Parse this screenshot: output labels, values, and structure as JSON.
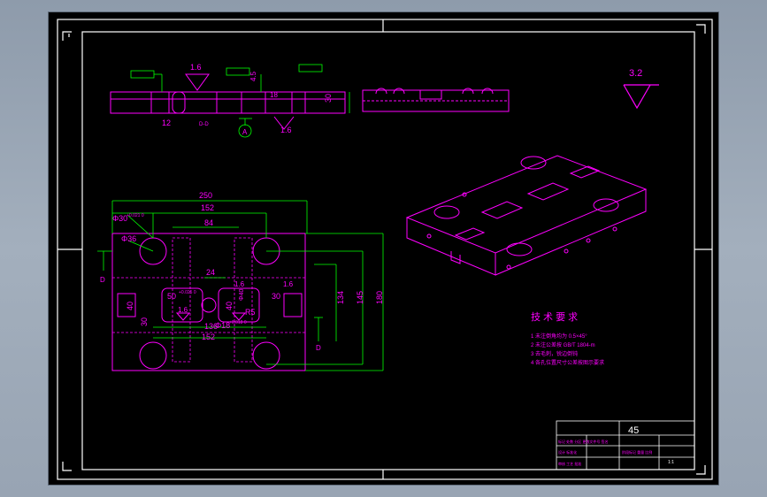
{
  "window": {
    "title": ""
  },
  "colors": {
    "background": "#000000",
    "frame": "#ffffff",
    "part": "#ff00ff",
    "dimension": "#00ff00",
    "text": "#ff00ff"
  },
  "top_view": {
    "dim_width": "250",
    "dim_152_top": "152",
    "dim_84": "84",
    "dim_24": "24",
    "dim_136": "136",
    "dim_152_bottom": "152",
    "dim_134": "134",
    "dim_145": "145",
    "dim_180": "180",
    "phi30": "Φ30",
    "phi30_tol": "+0.021 0",
    "phi36": "Φ36",
    "dim_50": "50",
    "dim_50_tol": "+0.025 0",
    "dim_40_left": "40",
    "dim_40_right": "40",
    "dim_30_left": "30",
    "dim_30_right": "30",
    "phi40": "Φ40",
    "phi18": "Φ18",
    "phi18_tol": "+0.018 0",
    "r5": "R5",
    "rough_16_a": "1.6",
    "rough_16_b": "1.6",
    "rough_16_c": "1.6",
    "label_d_left": "D",
    "label_d_right": "D"
  },
  "section_view": {
    "rough_top": "1.6",
    "rough_bottom": "1.6",
    "dim_12": "12",
    "dim_30": "30",
    "dim_18": "18",
    "dim_45": "4.5",
    "label_a": "A",
    "section_label": "D-D"
  },
  "roughness_corner": "3.2",
  "tech_requirements": {
    "title": "技 术 要 求",
    "items": [
      "1 未注倒角均为 0.5×45°",
      "2 未注公差按 GB/T 1804-m",
      "3 去毛刺，锐边倒钝",
      "4 各孔位置尺寸公差按图示要求"
    ]
  },
  "title_block": {
    "material": "45",
    "item_a": "标记 处数 分区 更改文件号 签名",
    "item_b": "设计 标准化",
    "item_c": "审核 工艺 批准",
    "item_d": "阶段标记 重量 比例",
    "scale_note": "1:1"
  }
}
